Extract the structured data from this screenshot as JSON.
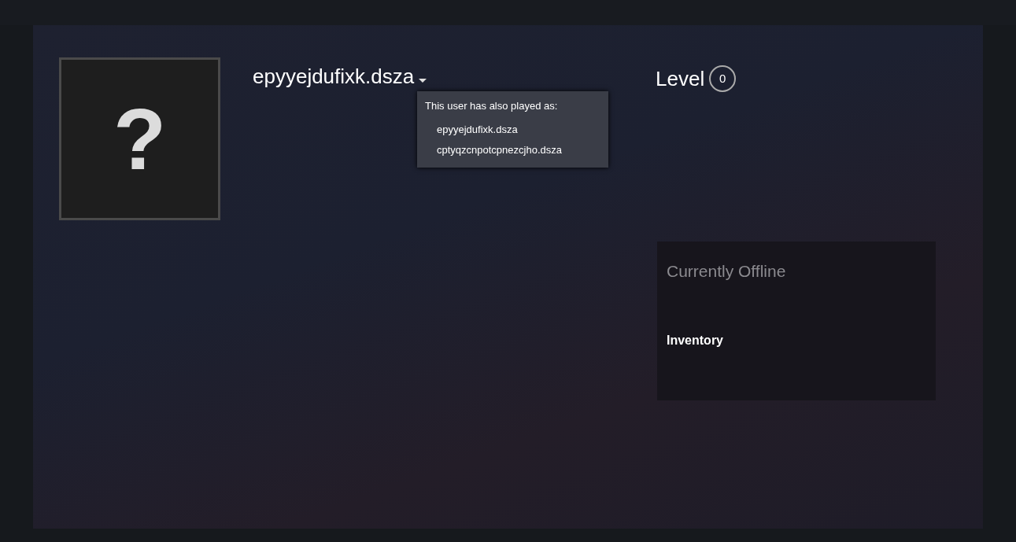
{
  "profile": {
    "avatar_glyph": "?",
    "name": "epyyejdufixk.dsza",
    "level_label": "Level",
    "level_value": "0"
  },
  "alias_popup": {
    "title": "This user has also played as:",
    "aliases": [
      "epyyejdufixk.dsza",
      "cptyqzcnpotcpnezcjho.dsza"
    ]
  },
  "status_card": {
    "status": "Currently Offline",
    "links": [
      "Inventory"
    ]
  }
}
